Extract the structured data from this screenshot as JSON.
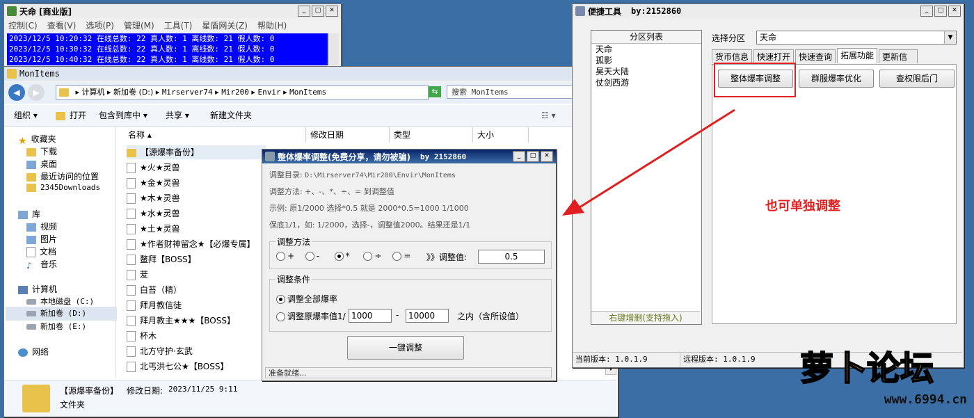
{
  "tianming": {
    "title": "天命 [商业版]",
    "menu": [
      "控制(C)",
      "查看(V)",
      "选项(P)",
      "管理(M)",
      "工具(T)",
      "星盾网关(Z)",
      "帮助(H)"
    ],
    "log": [
      "2023/12/5 10:20:32 在线总数: 22 真人数: 1 离线数: 21 假人数: 0",
      "2023/12/5 10:30:32 在线总数: 22 真人数: 1 离线数: 21 假人数: 0",
      "2023/12/5 10:40:32 在线总数: 22 真人数: 1 离线数: 21 假人数: 0"
    ]
  },
  "explorer": {
    "title": "MonItems",
    "breadcrumb": [
      "计算机",
      "新加卷 (D:)",
      "Mirserver74",
      "Mir200",
      "Envir",
      "MonItems"
    ],
    "search_placeholder": "搜索 MonItems",
    "toolbar": {
      "organize": "组织",
      "open": "打开",
      "include": "包含到库中",
      "share": "共享",
      "new_folder": "新建文件夹"
    },
    "nav": {
      "favorites": "收藏夹",
      "favorites_items": [
        "下载",
        "桌面",
        "最近访问的位置",
        "2345Downloads"
      ],
      "libraries": "库",
      "libraries_items": [
        "视频",
        "图片",
        "文档",
        "音乐"
      ],
      "computer": "计算机",
      "computer_items": [
        "本地磁盘 (C:)",
        "新加卷 (D:)",
        "新加卷 (E:)"
      ],
      "network": "网络"
    },
    "columns": [
      "名称",
      "修改日期",
      "类型",
      "大小"
    ],
    "files": [
      "【源爆率备份】",
      "★火★灵兽",
      "★金★灵兽",
      "★木★灵兽",
      "★水★灵兽",
      "★土★灵兽",
      "★作者财神留念★【必爆专属】",
      "鳌拜【BOSS】",
      "茇",
      "白苔（精）",
      "拜月教信徒",
      "拜月教主★★★【BOSS】",
      "杯木",
      "北方守护·玄武",
      "北丐洪七公★【BOSS】"
    ],
    "details": {
      "name": "【源爆率备份】",
      "modified_label": "修改日期:",
      "modified": "2023/11/25 9:11",
      "type": "文件夹"
    }
  },
  "adjust": {
    "title": "整体爆率调整(免费分享，请勿被骗)",
    "by": "by 2152860",
    "dir_label": "调整目录:",
    "dir_value": "D:\\Mirserver74\\Mir200\\Envir\\MonItems",
    "method_text": "调整方法: +、-、*、÷、=  到调整值",
    "example": "示例: 原1/2000 选择*0.5 就是 2000*0.5=1000  1/1000",
    "floor": "保底1/1，如: 1/2000，选择-，调整值2000。结果还是1/1",
    "method_group": "调整方法",
    "ops": [
      "+",
      "-",
      "*",
      "÷",
      "="
    ],
    "value_label": "》》调整值:",
    "value": "0.5",
    "cond_group": "调整条件",
    "cond_all": "调整全部爆率",
    "cond_range": "调整原爆率值1/",
    "range_from": "1000",
    "range_to": "10000",
    "range_dash": "-",
    "range_within": "之内（含所设值）",
    "apply": "一键调整",
    "status": "准备就绪..."
  },
  "tools": {
    "title": "便捷工具",
    "by": "by:2152860",
    "zone_list_label": "分区列表",
    "zones": [
      "天命",
      "孤影",
      "昊天大陆",
      "仗剑西游"
    ],
    "zone_hint": "右键增删(支持拖入)",
    "select_label": "选择分区",
    "selected": "天命",
    "tabs": [
      "货币信息",
      "快速打开",
      "快速查询",
      "拓展功能",
      "更新信息"
    ],
    "btn_overall": "整体爆率调整",
    "btn_group": "群服爆率优化",
    "btn_backdoor": "查权限后门",
    "cur_version": "当前版本: 1.0.1.9",
    "remote_version": "远程版本: 1.0.1.9"
  },
  "annotation": "也可单独调整",
  "watermark": {
    "text": "萝卜论坛",
    "url": "www.6994.cn"
  },
  "colors": {
    "accent": "#0a246a",
    "highlight_red": "#e02020",
    "log_bg": "#0000ff"
  }
}
